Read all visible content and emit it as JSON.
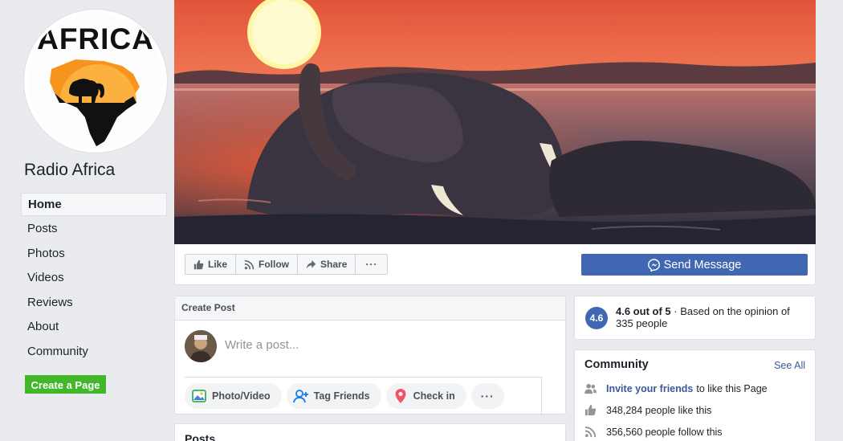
{
  "page": {
    "name": "Radio Africa",
    "logo_text": "AFRICA"
  },
  "nav": {
    "items": [
      {
        "label": "Home",
        "active": true
      },
      {
        "label": "Posts"
      },
      {
        "label": "Photos"
      },
      {
        "label": "Videos"
      },
      {
        "label": "Reviews"
      },
      {
        "label": "About"
      },
      {
        "label": "Community"
      }
    ],
    "create_page_label": "Create a Page"
  },
  "actions": {
    "like": "Like",
    "follow": "Follow",
    "share": "Share",
    "more": "···",
    "send_message": "Send Message"
  },
  "create_post": {
    "header": "Create Post",
    "placeholder": "Write a post...",
    "photo_video": "Photo/Video",
    "tag_friends": "Tag Friends",
    "check_in": "Check in",
    "more": "···"
  },
  "posts": {
    "title": "Posts"
  },
  "rating": {
    "badge": "4.6",
    "score_text": "4.6 out of 5",
    "sep": " · ",
    "rest": "Based on the opinion of 335 people"
  },
  "community": {
    "title": "Community",
    "see_all": "See All",
    "invite_link": "Invite your friends",
    "invite_rest": "to like this Page",
    "likes": "348,284 people like this",
    "follows": "356,560 people follow this"
  },
  "colors": {
    "accent": "#4267b2",
    "green": "#42b72a",
    "link": "#385898"
  }
}
